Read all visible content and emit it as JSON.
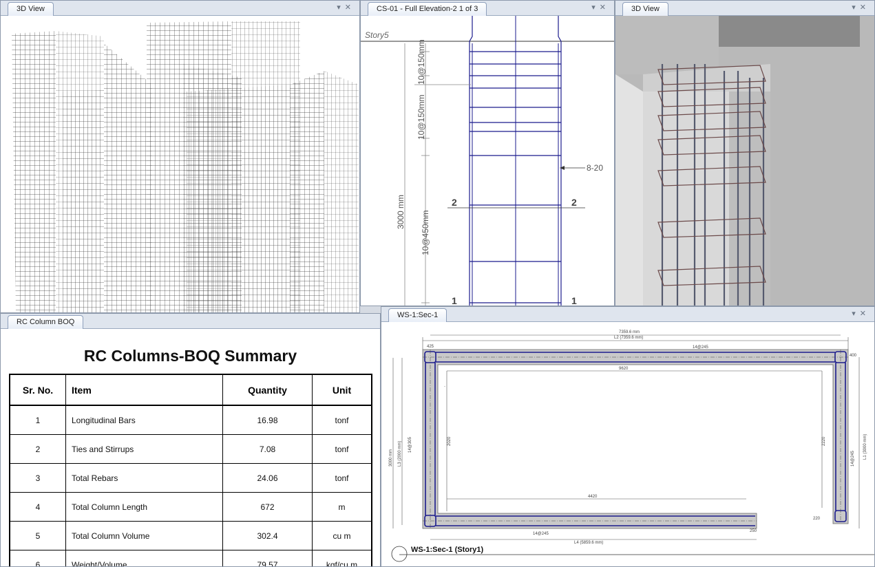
{
  "panels": {
    "view3d_left": {
      "tab": "3D View"
    },
    "elevation": {
      "tab": "CS-01 - Full Elevation-2 1 of 3"
    },
    "view3d_right": {
      "tab": "3D View"
    },
    "boq": {
      "tab": "RC Column BOQ"
    },
    "section": {
      "tab": "WS-1:Sec-1"
    }
  },
  "elevation": {
    "story": "Story5",
    "dim_3000": "3000 mm",
    "spacing_top": "10@150mm",
    "spacing_mid": "10@150mm",
    "spacing_bottom": "10@450mm",
    "bar_label": "8-20",
    "section_mark_2": "2",
    "section_mark_1": "1"
  },
  "boq": {
    "title": "RC Columns-BOQ Summary",
    "headers": {
      "sr": "Sr. No.",
      "item": "Item",
      "quantity": "Quantity",
      "unit": "Unit"
    },
    "rows": [
      {
        "sr": "1",
        "item": "Longitudinal Bars",
        "quantity": "16.98",
        "unit": "tonf"
      },
      {
        "sr": "2",
        "item": "Ties and Stirrups",
        "quantity": "7.08",
        "unit": "tonf"
      },
      {
        "sr": "3",
        "item": "Total Rebars",
        "quantity": "24.06",
        "unit": "tonf"
      },
      {
        "sr": "4",
        "item": "Total Column Length",
        "quantity": "672",
        "unit": "m"
      },
      {
        "sr": "5",
        "item": "Total Column Volume",
        "quantity": "302.4",
        "unit": "cu m"
      },
      {
        "sr": "6",
        "item": "Weight/Volume",
        "quantity": "79.57",
        "unit": "kgf/cu m"
      }
    ]
  },
  "section": {
    "dim_top": "7359.6 mm",
    "dim_l2": "L2 (7359.6 mm)",
    "dim_425": "425",
    "dim_14_245_top": "14@245",
    "dim_9620": "9620",
    "dim_3000_left": "3000 mm",
    "dim_l3": "L3 (2000 mm)",
    "dim_14_305": "14@305",
    "dim_2020": "2020",
    "dim_2220": "2220",
    "dim_14_245_right": "14@245",
    "dim_l1": "L1 (3000 mm)",
    "dim_400": "400",
    "dim_4420": "4420",
    "dim_14_245_bottom": "14@245",
    "dim_l4": "L4 (5859.6 mm)",
    "dim_220": "220",
    "dim_250": "250",
    "caption": "WS-1:Sec-1 (Story1)"
  },
  "colors": {
    "rebar": "#1a1a8c",
    "concrete": "#c9c9c9",
    "tab_bg": "#dfe5ee"
  }
}
